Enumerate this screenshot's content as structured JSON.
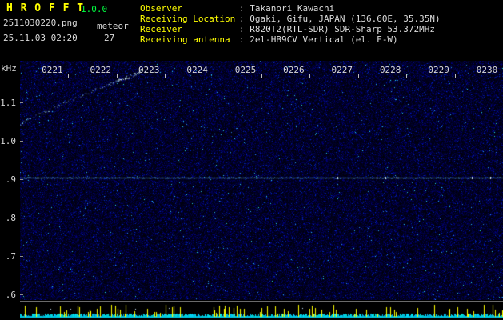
{
  "app": {
    "title": "H R O F F T",
    "version": "1.0.0",
    "filename": "2511030220.png",
    "mode_label": "meteor",
    "timestamp": "25.11.03 02:20",
    "count": "27"
  },
  "station": {
    "rows": [
      {
        "label": "Observer",
        "value": "Takanori Kawachi"
      },
      {
        "label": "Receiving Location",
        "value": "Ogaki, Gifu, JAPAN (136.60E, 35.35N)"
      },
      {
        "label": "Receiver",
        "value": "R820T2(RTL-SDR) SDR-Sharp 53.372MHz"
      },
      {
        "label": "Receiving antenna",
        "value": "2el-HB9CV Vertical (el. E-W)"
      }
    ]
  },
  "chart_data": {
    "type": "heatmap",
    "subtype": "meteor-radio-spectrogram",
    "title": "HROFFT 10-minute radio meteor spectrogram",
    "x_tick_labels": [
      "0221",
      "0222",
      "0223",
      "0224",
      "0225",
      "0226",
      "0227",
      "0228",
      "0229",
      "0230"
    ],
    "x_range": [
      "02:20",
      "02:30"
    ],
    "y_axis_unit_label": "kHz",
    "y_tick_labels": [
      "1.1",
      "1.0",
      ".9",
      ".8",
      ".7",
      ".6"
    ],
    "y_tick_values": [
      1.1,
      1.0,
      0.9,
      0.8,
      0.7,
      0.6
    ],
    "y_range_khz": [
      0.585,
      1.208
    ],
    "carrier_line_khz": 0.905,
    "drifting_echo": {
      "description": "dotted rising doppler trace (aircraft/long-duration echo) in upper-left",
      "start": {
        "minute_offset": 0.0,
        "khz": 1.045
      },
      "end": {
        "minute_offset": 2.55,
        "khz": 1.183
      }
    },
    "noise_floor": "dark blue speckle over black",
    "bottom_strip": "broadband signal-level bars: cyan baseline with yellow peaks",
    "grid": false,
    "legend_position": "none"
  },
  "colors": {
    "background": "#000000",
    "title_yellow": "#ffff00",
    "version_green": "#00ff41",
    "text_white": "#dcdcdc",
    "axis_text": "#d8d8d8",
    "carrier_cyan": "#82f0ff",
    "strip_cyan": "#00d4f0",
    "strip_yellow": "#ffff00",
    "noise_blue": "#0000a0"
  },
  "render": {
    "seed": 20251103
  }
}
